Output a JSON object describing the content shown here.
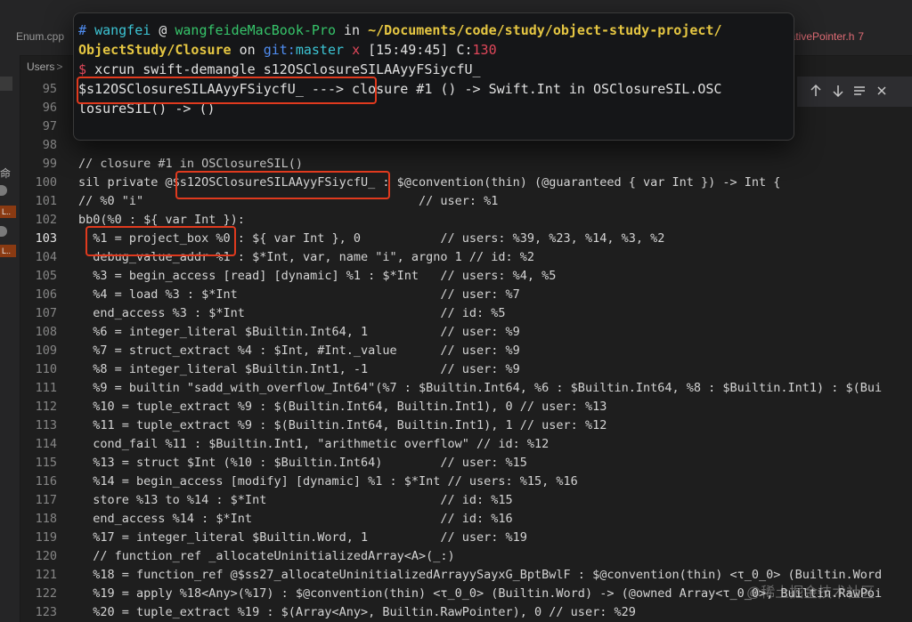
{
  "tabs": {
    "left_label": "Enum.cpp",
    "right_label": "lativePointer.h",
    "right_badge": "7"
  },
  "breadcrumb": {
    "label": "Users",
    "chevron": ">"
  },
  "sidebar": {
    "badge1": "L..",
    "badge2": "L..",
    "glyph": "命"
  },
  "find_widget": {
    "prev_icon": "arrow-up",
    "next_icon": "arrow-down",
    "selection_icon": "lines",
    "close_icon": "close"
  },
  "terminal": {
    "prompt_hash": "#",
    "user": "wangfei",
    "at": "@",
    "host": "wangfeideMacBook-Pro",
    "in": "in",
    "path_part1": "~/Documents/code/study/object-study-project/",
    "path_part2": "ObjectStudy/Closure",
    "on": "on",
    "git": "git:",
    "branch": "master",
    "dirty": "x",
    "time": "[15:49:45]",
    "exit_label": "C:",
    "exit_code": "130",
    "dollar": "$",
    "command": "xcrun swift-demangle s12OSClosureSILAAyyFSiycfU_",
    "output1_symbol": "$s12OSClosureSILAAyyFSiycfU_ --->",
    "output1_rest": "closure #1 () -> Swift.Int in OSClosureSIL.OSC",
    "output2": "losureSIL() -> ()"
  },
  "code_lines": [
    {
      "num": "95",
      "text": ""
    },
    {
      "num": "96",
      "text": ""
    },
    {
      "num": "97",
      "text": ""
    },
    {
      "num": "98",
      "text": ""
    },
    {
      "num": "99",
      "text": "// closure #1 in OSClosureSIL()"
    },
    {
      "num": "100",
      "text": "sil private @$s12OSClosureSILAAyyFSiycfU_ : $@convention(thin) (@guaranteed { var Int }) -> Int {"
    },
    {
      "num": "101",
      "text": "// %0 \"i\"                                      // user: %1"
    },
    {
      "num": "102",
      "text": "bb0(%0 : ${ var Int }):"
    },
    {
      "num": "103",
      "text": "  %1 = project_box %0 : ${ var Int }, 0           // users: %39, %23, %14, %3, %2"
    },
    {
      "num": "104",
      "text": "  debug_value_addr %1 : $*Int, var, name \"i\", argno 1 // id: %2"
    },
    {
      "num": "105",
      "text": "  %3 = begin_access [read] [dynamic] %1 : $*Int   // users: %4, %5"
    },
    {
      "num": "106",
      "text": "  %4 = load %3 : $*Int                            // user: %7"
    },
    {
      "num": "107",
      "text": "  end_access %3 : $*Int                           // id: %5"
    },
    {
      "num": "108",
      "text": "  %6 = integer_literal $Builtin.Int64, 1          // user: %9"
    },
    {
      "num": "109",
      "text": "  %7 = struct_extract %4 : $Int, #Int._value      // user: %9"
    },
    {
      "num": "110",
      "text": "  %8 = integer_literal $Builtin.Int1, -1          // user: %9"
    },
    {
      "num": "111",
      "text": "  %9 = builtin \"sadd_with_overflow_Int64\"(%7 : $Builtin.Int64, %6 : $Builtin.Int64, %8 : $Builtin.Int1) : $(Bui"
    },
    {
      "num": "112",
      "text": "  %10 = tuple_extract %9 : $(Builtin.Int64, Builtin.Int1), 0 // user: %13"
    },
    {
      "num": "113",
      "text": "  %11 = tuple_extract %9 : $(Builtin.Int64, Builtin.Int1), 1 // user: %12"
    },
    {
      "num": "114",
      "text": "  cond_fail %11 : $Builtin.Int1, \"arithmetic overflow\" // id: %12"
    },
    {
      "num": "115",
      "text": "  %13 = struct $Int (%10 : $Builtin.Int64)        // user: %15"
    },
    {
      "num": "116",
      "text": "  %14 = begin_access [modify] [dynamic] %1 : $*Int // users: %15, %16"
    },
    {
      "num": "117",
      "text": "  store %13 to %14 : $*Int                        // id: %15"
    },
    {
      "num": "118",
      "text": "  end_access %14 : $*Int                          // id: %16"
    },
    {
      "num": "119",
      "text": "  %17 = integer_literal $Builtin.Word, 1          // user: %19"
    },
    {
      "num": "120",
      "text": "  // function_ref _allocateUninitializedArray<A>(_:)"
    },
    {
      "num": "121",
      "text": "  %18 = function_ref @$ss27_allocateUninitializedArrayySayxG_BptBwlF : $@convention(thin) <τ_0_0> (Builtin.Word"
    },
    {
      "num": "122",
      "text": "  %19 = apply %18<Any>(%17) : $@convention(thin) <τ_0_0> (Builtin.Word) -> (@owned Array<τ_0_0>, Builtin.RawPoi"
    },
    {
      "num": "123",
      "text": "  %20 = tuple_extract %19 : $(Array<Any>, Builtin.RawPointer), 0 // user: %29"
    }
  ],
  "current_line": "103",
  "watermark": "@稀土掘金技术社区",
  "colors": {
    "background": "#1e1e1e",
    "terminal_bg": "#151618",
    "annotation_red": "#e03a1e",
    "prompt_blue": "#4f8cf0",
    "host_green": "#36c46a",
    "path_yellow": "#e5c642",
    "branch_cyan": "#3cc4d4",
    "error_red": "#e0475a"
  }
}
